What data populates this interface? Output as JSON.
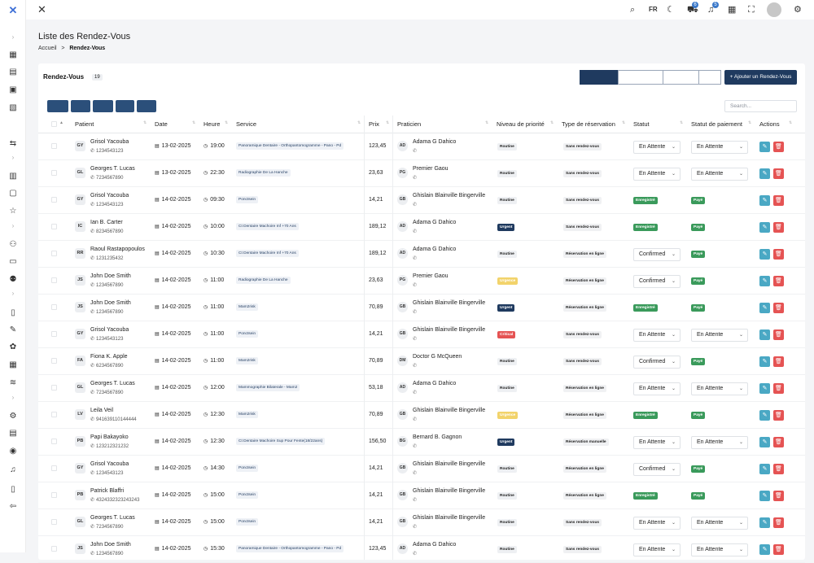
{
  "header": {
    "lang": "FR",
    "cart_badge": "6",
    "bell_badge": "5"
  },
  "page": {
    "title": "Liste des Rendez-Vous",
    "crumb_home": "Accueil",
    "crumb_sep": ">",
    "crumb_current": "Rendez-Vous"
  },
  "card": {
    "title": "Rendez-Vous",
    "count": "19"
  },
  "filters": [
    {
      "label": "Aujourd'hui",
      "active": true
    },
    {
      "label": "Cette semaine"
    },
    {
      "label": "Ce mois-ci"
    },
    {
      "label": "Tout"
    }
  ],
  "add_label": "+ Ajouter un Rendez-Vous",
  "exports": [
    "Copy",
    "CSV",
    "Excel",
    "PDF",
    "Print"
  ],
  "search_placeholder": "Search...",
  "columns": [
    "Patient",
    "Date",
    "Heure",
    "Service",
    "Prix",
    "Praticien",
    "Niveau de priorité",
    "Type de réservation",
    "Statut",
    "Statut de paiement",
    "Actions"
  ],
  "status_options": {
    "waiting": "En Attente",
    "confirmed": "Confirmed"
  },
  "rows": [
    {
      "i": "GY",
      "n": "Grisol Yacouba",
      "p": "1234543123",
      "d": "13-02-2025",
      "t": "19:00",
      "s": "Panoramique Dentaire - Orthopantomogramme - Pano - Pd",
      "x": "123,45",
      "pi": "AD",
      "pr": "Adama G Dahico",
      "pp": "",
      "pp2": "Routine",
      "ty": "Sans rendez-vous",
      "st": "En Attente",
      "pay": "En Attente"
    },
    {
      "i": "GL",
      "n": "Georges T. Lucas",
      "p": "7234567890",
      "d": "13-02-2025",
      "t": "22:30",
      "s": "Radiographie De La Hanche",
      "x": "23,63",
      "pi": "PG",
      "pr": "Premier Gaou",
      "pp": "",
      "pp2": "Routine",
      "ty": "Sans rendez-vous",
      "st": "En Attente",
      "pay": "En Attente"
    },
    {
      "i": "GY",
      "n": "Grisol Yacouba",
      "p": "1234543123",
      "d": "14-02-2025",
      "t": "09:30",
      "s": "Ponctsein",
      "x": "14,21",
      "pi": "GB",
      "pr": "Ghislain Blainville Bingerville",
      "pp": "",
      "pp2": "Routine",
      "ty": "Sans rendez-vous",
      "st": "Enregistré",
      "pay": "Payé"
    },
    {
      "i": "IC",
      "n": "Ian B. Carter",
      "p": "8234567890",
      "d": "14-02-2025",
      "t": "10:00",
      "s": "Ct Dentaire Machoire Inf +70 Ans",
      "x": "189,12",
      "pi": "AD",
      "pr": "Adama G Dahico",
      "pp": "",
      "pp2": "Urgent",
      "ty": "Sans rendez-vous",
      "st": "Enregistré",
      "pay": "Payé"
    },
    {
      "i": "RR",
      "n": "Raoul Rastapopoulos",
      "p": "1231235432",
      "d": "14-02-2025",
      "t": "10:30",
      "s": "Ct Dentaire Machoire Inf +70 Ans",
      "x": "189,12",
      "pi": "AD",
      "pr": "Adama G Dahico",
      "pp": "",
      "pp2": "Routine",
      "ty": "Réservation en ligne",
      "st": "Confirmed",
      "pay": "Payé"
    },
    {
      "i": "JS",
      "n": "John Doe Smith",
      "p": "1234567890",
      "d": "14-02-2025",
      "t": "11:00",
      "s": "Radiographie De La Hanche",
      "x": "23,63",
      "pi": "PG",
      "pr": "Premier Gaou",
      "pp": "",
      "pp2": "Urgence",
      "ty": "Réservation en ligne",
      "st": "Confirmed",
      "pay": "Payé"
    },
    {
      "i": "JS",
      "n": "John Doe Smith",
      "p": "1234567890",
      "d": "14-02-2025",
      "t": "11:00",
      "s": "Mam2risk",
      "x": "70,89",
      "pi": "GB",
      "pr": "Ghislain Blainville Bingerville",
      "pp": "",
      "pp2": "Urgent",
      "ty": "Réservation en ligne",
      "st": "Enregistré",
      "pay": "Payé"
    },
    {
      "i": "GY",
      "n": "Grisol Yacouba",
      "p": "1234543123",
      "d": "14-02-2025",
      "t": "11:00",
      "s": "Ponctsein",
      "x": "14,21",
      "pi": "GB",
      "pr": "Ghislain Blainville Bingerville",
      "pp": "",
      "pp2": "Critical",
      "ty": "Sans rendez-vous",
      "st": "En Attente",
      "pay": "En Attente"
    },
    {
      "i": "FA",
      "n": "Fiona K. Apple",
      "p": "6234567890",
      "d": "14-02-2025",
      "t": "11:00",
      "s": "Mam2risk",
      "x": "70,89",
      "pi": "DM",
      "pr": "Doctor G McQueen",
      "pp": "",
      "pp2": "Routine",
      "ty": "Sans rendez-vous",
      "st": "Confirmed",
      "pay": "Payé"
    },
    {
      "i": "GL",
      "n": "Georges T. Lucas",
      "p": "7234567890",
      "d": "14-02-2025",
      "t": "12:00",
      "s": "Mammographie Bilaterale - Mam2",
      "x": "53,18",
      "pi": "AD",
      "pr": "Adama G Dahico",
      "pp": "",
      "pp2": "Routine",
      "ty": "Réservation en ligne",
      "st": "En Attente",
      "pay": "En Attente"
    },
    {
      "i": "LV",
      "n": "Leila Veil",
      "p": "941639110144444",
      "d": "14-02-2025",
      "t": "12:30",
      "s": "Mam2risk",
      "x": "70,89",
      "pi": "GB",
      "pr": "Ghislain Blainville Bingerville",
      "pp": "",
      "pp2": "Urgence",
      "ty": "Réservation en ligne",
      "st": "Enregistré",
      "pay": "Payé"
    },
    {
      "i": "PB",
      "n": "Papi Bakayoko",
      "p": "123212321232",
      "d": "14-02-2025",
      "t": "12:30",
      "s": "Ct Dentaire Machoire Sup Pour Fente(18/22ans)",
      "x": "156,50",
      "pi": "BG",
      "pr": "Bernard B. Gagnon",
      "pp": "",
      "pp2": "Urgent",
      "ty": "Réservation manuelle",
      "st": "En Attente",
      "pay": "En Attente"
    },
    {
      "i": "GY",
      "n": "Grisol Yacouba",
      "p": "1234543123",
      "d": "14-02-2025",
      "t": "14:30",
      "s": "Ponctsein",
      "x": "14,21",
      "pi": "GB",
      "pr": "Ghislain Blainville Bingerville",
      "pp": "",
      "pp2": "Routine",
      "ty": "Réservation en ligne",
      "st": "Confirmed",
      "pay": "Payé"
    },
    {
      "i": "PB",
      "n": "Patrick Blaffri",
      "p": "4324332323243243",
      "d": "14-02-2025",
      "t": "15:00",
      "s": "Ponctsein",
      "x": "14,21",
      "pi": "GB",
      "pr": "Ghislain Blainville Bingerville",
      "pp": "",
      "pp2": "Routine",
      "ty": "Réservation en ligne",
      "st": "Enregistré",
      "pay": "Payé"
    },
    {
      "i": "GL",
      "n": "Georges T. Lucas",
      "p": "7234567890",
      "d": "14-02-2025",
      "t": "15:00",
      "s": "Ponctsein",
      "x": "14,21",
      "pi": "GB",
      "pr": "Ghislain Blainville Bingerville",
      "pp": "",
      "pp2": "Routine",
      "ty": "Sans rendez-vous",
      "st": "En Attente",
      "pay": "En Attente"
    },
    {
      "i": "JS",
      "n": "John Doe Smith",
      "p": "1234567890",
      "d": "14-02-2025",
      "t": "15:30",
      "s": "Panoramique Dentaire - Orthopantomogramme - Pano - Pd",
      "x": "123,45",
      "pi": "AD",
      "pr": "Adama G Dahico",
      "pp": "",
      "pp2": "Routine",
      "ty": "Sans rendez-vous",
      "st": "En Attente",
      "pay": "En Attente"
    }
  ]
}
